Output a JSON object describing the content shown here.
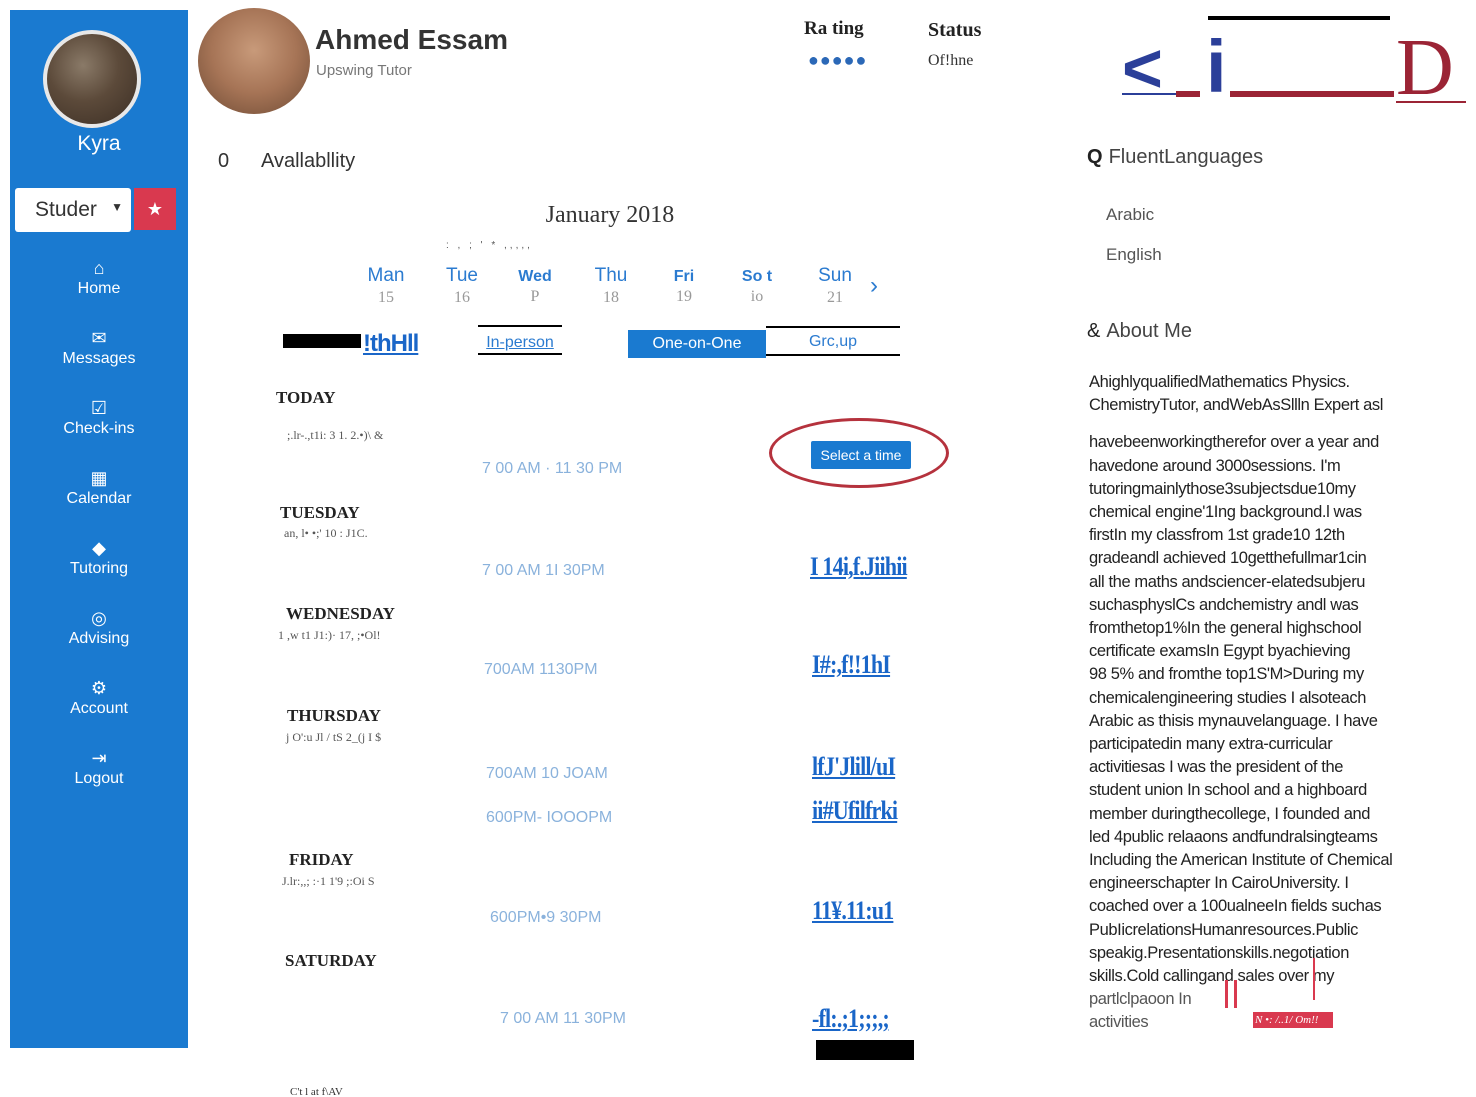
{
  "sidebar": {
    "user_name": "Kyra",
    "role_select": "Studer",
    "star_icon": "star-icon",
    "items": [
      {
        "label": "Home",
        "icon": "home-icon",
        "glyph": "⌂"
      },
      {
        "label": "Messages",
        "icon": "envelope-icon",
        "glyph": "✉"
      },
      {
        "label": "Check-ins",
        "icon": "checkbox-icon",
        "glyph": "☑"
      },
      {
        "label": "Calendar",
        "icon": "calendar-icon",
        "glyph": "▦"
      },
      {
        "label": "Tutoring",
        "icon": "graduation-cap-icon",
        "glyph": "◆"
      },
      {
        "label": "Advising",
        "icon": "lifebuoy-icon",
        "glyph": "◎"
      },
      {
        "label": "Account",
        "icon": "gear-icon",
        "glyph": "⚙"
      },
      {
        "label": "Logout",
        "icon": "logout-icon",
        "glyph": "⇥"
      }
    ],
    "color": "#1a7ad0"
  },
  "header": {
    "tutor_name": "Ahmed Essam",
    "tutor_subtitle": "Upswing Tutor",
    "rating_label": "Ra ting",
    "rating_dots": "●●●●●",
    "status_label": "Status",
    "status_value": "Of!hne",
    "logo_text": {
      "left": "<",
      "mid": "i",
      "right": "D"
    }
  },
  "availability": {
    "number": "0",
    "title": "Avallabllity",
    "month": "January 2018",
    "noise": ": , ;        ' *  ,,,,,",
    "days": [
      {
        "name": "Man",
        "num": "15",
        "bold": false
      },
      {
        "name": "Tue",
        "num": "16",
        "bold": false
      },
      {
        "name": "Wed",
        "num": "P",
        "bold": true
      },
      {
        "name": "Thu",
        "num": "18",
        "bold": false
      },
      {
        "name": "Fri",
        "num": "19",
        "bold": true
      },
      {
        "name": "So t",
        "num": "io",
        "bold": true
      },
      {
        "name": "Sun",
        "num": "21",
        "bold": false
      }
    ],
    "next_arrow": "›",
    "filter_text": "!thHll",
    "filter_options": [
      "In-person",
      "One-on-One",
      "Grc,up"
    ],
    "schedule": [
      {
        "day": "TODAY",
        "sub": ";.lr-.,t1i: 3 1. 2.•)\\ &",
        "time": "7 00 AM · 11 30 PM",
        "action": "Select a time"
      },
      {
        "day": "TUESDAY",
        "sub": "an, l• •;' 10 : J1C.",
        "time": "7 00 AM  1I  30PM",
        "action": "I 14i,f.Jiihii"
      },
      {
        "day": "WEDNESDAY",
        "sub": "1 ,w t1 J1:)· 17, ;•Ol!",
        "time": "700AM  1130PM",
        "action": "I#:,f!!1hI"
      },
      {
        "day": "THURSDAY",
        "sub": "j O':u Jl / tS 2_(j I $",
        "time": "700AM  10 JOAM",
        "action": "lfJ'Jlill/uI"
      },
      {
        "day": "",
        "sub": "",
        "time": "600PM- IOOOPM",
        "action": "ii#Ufilfrki"
      },
      {
        "day": "FRIDAY",
        "sub": "J.lr:,,; :·1 1'9 ;:Oi S",
        "time": "600PM•9 30PM",
        "action": "11¥.11:u1"
      },
      {
        "day": "SATURDAY",
        "sub": "",
        "time": "7 00 AM 11 30PM",
        "action": "-fl:.;1;;;,;"
      }
    ],
    "footer_noise": "C't l at f\\AV"
  },
  "languages": {
    "icon": "Q",
    "title": "FluentLanguages",
    "items": [
      "Arabic",
      "English"
    ]
  },
  "about": {
    "icon": "&",
    "title": "About Me",
    "lines": [
      "AhighlyqualifiedMathematics Physics.",
      "ChemistryTutor, andWebAsSllln Expert asl",
      "",
      "havebeenworkingtherefor over a year and",
      "havedone around 3000sessions. I'm",
      "tutoringmainlythose3subjectsdue10my",
      "chemical engine'1Ing background.l was",
      "firstIn my classfrom 1st grade10 12th",
      "gradeandl achieved 10getthefullmar1cin",
      "all the maths andsciencer-elatedsubjeru",
      "suchasphyslCs andchemistry andl was",
      "fromthetop1%In the general highschool",
      "certificate examsIn Egypt byachieving",
      "98 5% and fromthe top1S'M>During my",
      "chemicalengineering studies I alsoteach",
      "Arabic as thisis mynauvelanguage. I have",
      "participatedin many extra-curricular",
      "activitiesas I was the president of the",
      "student union In school and a highboard",
      "member duringthecollege, I founded and",
      "led 4public relaaons andfundralsingteams",
      "Including the American Institute of Chemical",
      "engineerschapter In CairoUniversity. I",
      "coached over a 100ualneeIn fields suchas",
      "PubIicrelationsHumanresources.Public",
      "speakig.Presentationskills.negotiation",
      "skills.Cold callingand sales over my",
      "partlclpaoon In",
      "activities"
    ],
    "footer_red": "N •: /..1/ Om!!"
  },
  "colors": {
    "accent": "#1a7ad0",
    "link": "#1a66c8",
    "red": "#d9394f",
    "logo": "#2b3f99",
    "logo_red": "#9b2435"
  }
}
